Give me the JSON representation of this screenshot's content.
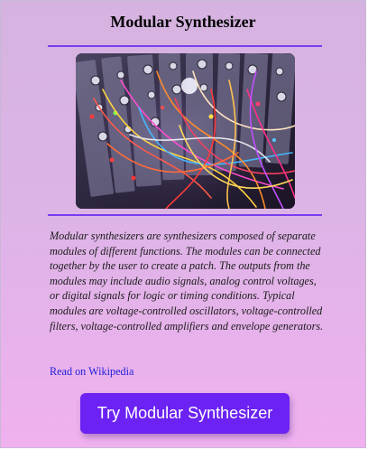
{
  "card": {
    "title": "Modular Synthesizer",
    "image_alt": "Modular synthesizer with patch cables",
    "description": "Modular synthesizers are synthesizers composed of separate modules of different functions. The modules can be connected together by the user to create a patch. The outputs from the modules may include audio signals, analog control voltages, or digital signals for logic or timing conditions. Typical modules are voltage-controlled oscillators, voltage-controlled filters, voltage-controlled amplifiers and envelope generators.",
    "wiki_link_label": "Read on Wikipedia",
    "button_label": "Try Modular Synthesizer"
  },
  "colors": {
    "accent": "#6b22f2",
    "divider": "#7a3cf0",
    "link": "#1f1fd8",
    "background_top": "#d5b3e0",
    "background_bottom": "#f0b1ef"
  }
}
